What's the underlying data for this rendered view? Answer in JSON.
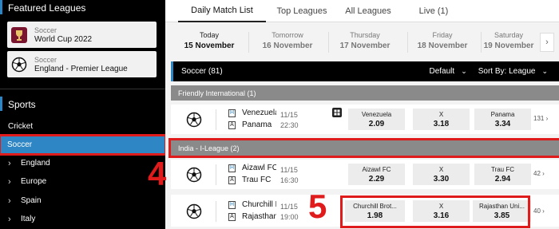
{
  "sidebar": {
    "featured_title": "Featured Leagues",
    "featured": [
      {
        "sport": "Soccer",
        "name": "World Cup 2022",
        "icon": "world-cup-icon"
      },
      {
        "sport": "Soccer",
        "name": "England - Premier League",
        "icon": "soccer-ball-icon"
      }
    ],
    "sports_title": "Sports",
    "items": [
      {
        "label": "Cricket"
      },
      {
        "label": "Soccer",
        "active": true
      },
      {
        "label": "England"
      },
      {
        "label": "Europe"
      },
      {
        "label": "Spain"
      },
      {
        "label": "Italy"
      }
    ]
  },
  "annotations": {
    "step4": "4",
    "step5": "5"
  },
  "tabs": [
    {
      "label": "Daily Match List",
      "active": true
    },
    {
      "label": "Top Leagues"
    },
    {
      "label": "All Leagues"
    },
    {
      "label": "Live (1)"
    }
  ],
  "dates": [
    {
      "dow": "Today",
      "date": "15 November",
      "active": true
    },
    {
      "dow": "Tomorrow",
      "date": "16 November"
    },
    {
      "dow": "Thursday",
      "date": "17 November"
    },
    {
      "dow": "Friday",
      "date": "18 November"
    },
    {
      "dow": "Saturday",
      "date": "19 November"
    }
  ],
  "dates_next": "›",
  "sport_bar": {
    "title": "Soccer (81)",
    "default_label": "Default",
    "sort_label": "Sort By: League"
  },
  "leagues": [
    {
      "name": "Friendly International (1)",
      "matches": [
        {
          "home": "Venezuela",
          "away": "Panama",
          "date": "11/15",
          "time": "22:30",
          "has_stats": true,
          "odds": [
            {
              "label": "Venezuela",
              "value": "2.09"
            },
            {
              "label": "X",
              "value": "3.18"
            },
            {
              "label": "Panama",
              "value": "3.34"
            }
          ],
          "more": "131 ›"
        }
      ]
    },
    {
      "name": "India - I-League (2)",
      "matches": [
        {
          "home": "Aizawl FC",
          "away": "Trau FC",
          "date": "11/15",
          "time": "16:30",
          "odds": [
            {
              "label": "Aizawl FC",
              "value": "2.29"
            },
            {
              "label": "X",
              "value": "3.30"
            },
            {
              "label": "Trau FC",
              "value": "2.94"
            }
          ],
          "more": "42 ›"
        },
        {
          "home": "Churchill Brothers",
          "away": "Rajasthan United",
          "date": "11/15",
          "time": "19:00",
          "odds": [
            {
              "label": "Churchill Brot...",
              "value": "1.98"
            },
            {
              "label": "X",
              "value": "3.16"
            },
            {
              "label": "Rajasthan Uni...",
              "value": "3.85"
            }
          ],
          "more": "40 ›"
        }
      ]
    }
  ],
  "ha": {
    "home": "H",
    "away": "A"
  },
  "colors": {
    "accent": "#2f86c4",
    "highlight": "#e01b1b",
    "sidebar_bg": "#000000",
    "league_bar": "#8a8a8a"
  }
}
